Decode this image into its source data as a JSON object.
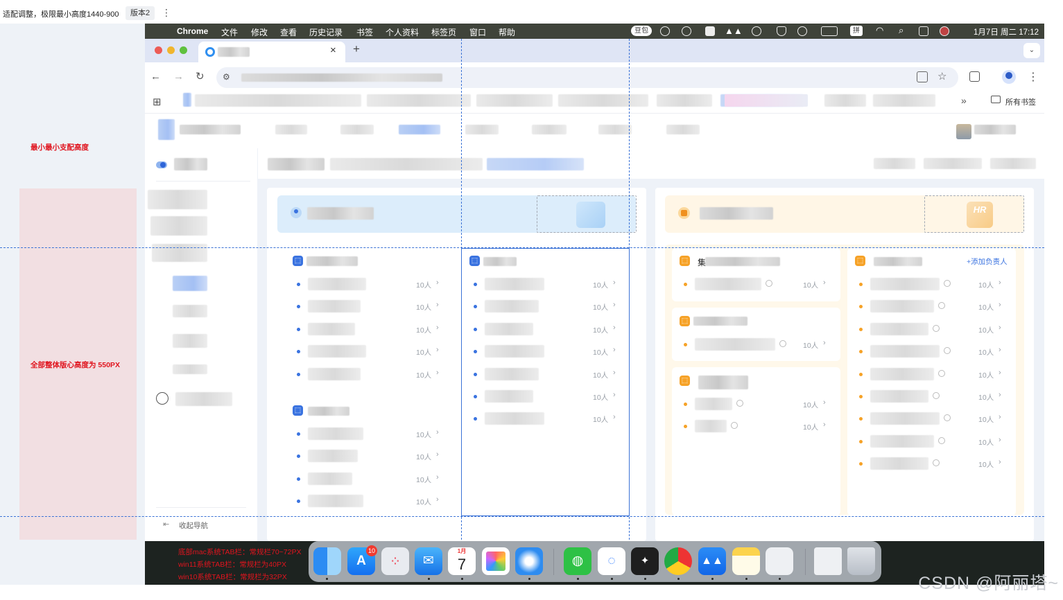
{
  "top": {
    "note": "适配调整，极限最小高度1440-900",
    "version": "版本2"
  },
  "annotations": {
    "min_height": "最小最小支配高度",
    "center_height": "全部整体版心高度为 550PX",
    "taskbar": [
      "底部mac系统TAB栏：常规栏70~72PX",
      "win11系统TAB栏：常规栏为40PX",
      "win10系统TAB栏：常规栏为32PX"
    ]
  },
  "menubar": {
    "items": [
      "Chrome",
      "文件",
      "修改",
      "查看",
      "历史记录",
      "书签",
      "个人资料",
      "标签页",
      "窗口",
      "帮助"
    ],
    "badge": "豆包",
    "ime": "拼",
    "clock": "1月7日 周二  17:12"
  },
  "chrome": {
    "close_tab": "×",
    "new_tab": "+",
    "bookmarks_all": "所有书签",
    "overflow": "»"
  },
  "sidebar": {
    "collapse": "收起导航"
  },
  "content": {
    "count_label": "10人",
    "add_owner": "+添加负责人",
    "card3_title_prefix": "集",
    "hr_watermark": "HR"
  },
  "dock": {
    "badge": "10",
    "calendar_month": "1月",
    "calendar_day": "7"
  },
  "watermark": "CSDN @阿丽塔~",
  "colors": {
    "primary": "#3a73e0",
    "orange": "#f6a227",
    "menubar": "#3f433a",
    "guide": "#3a72d6"
  }
}
